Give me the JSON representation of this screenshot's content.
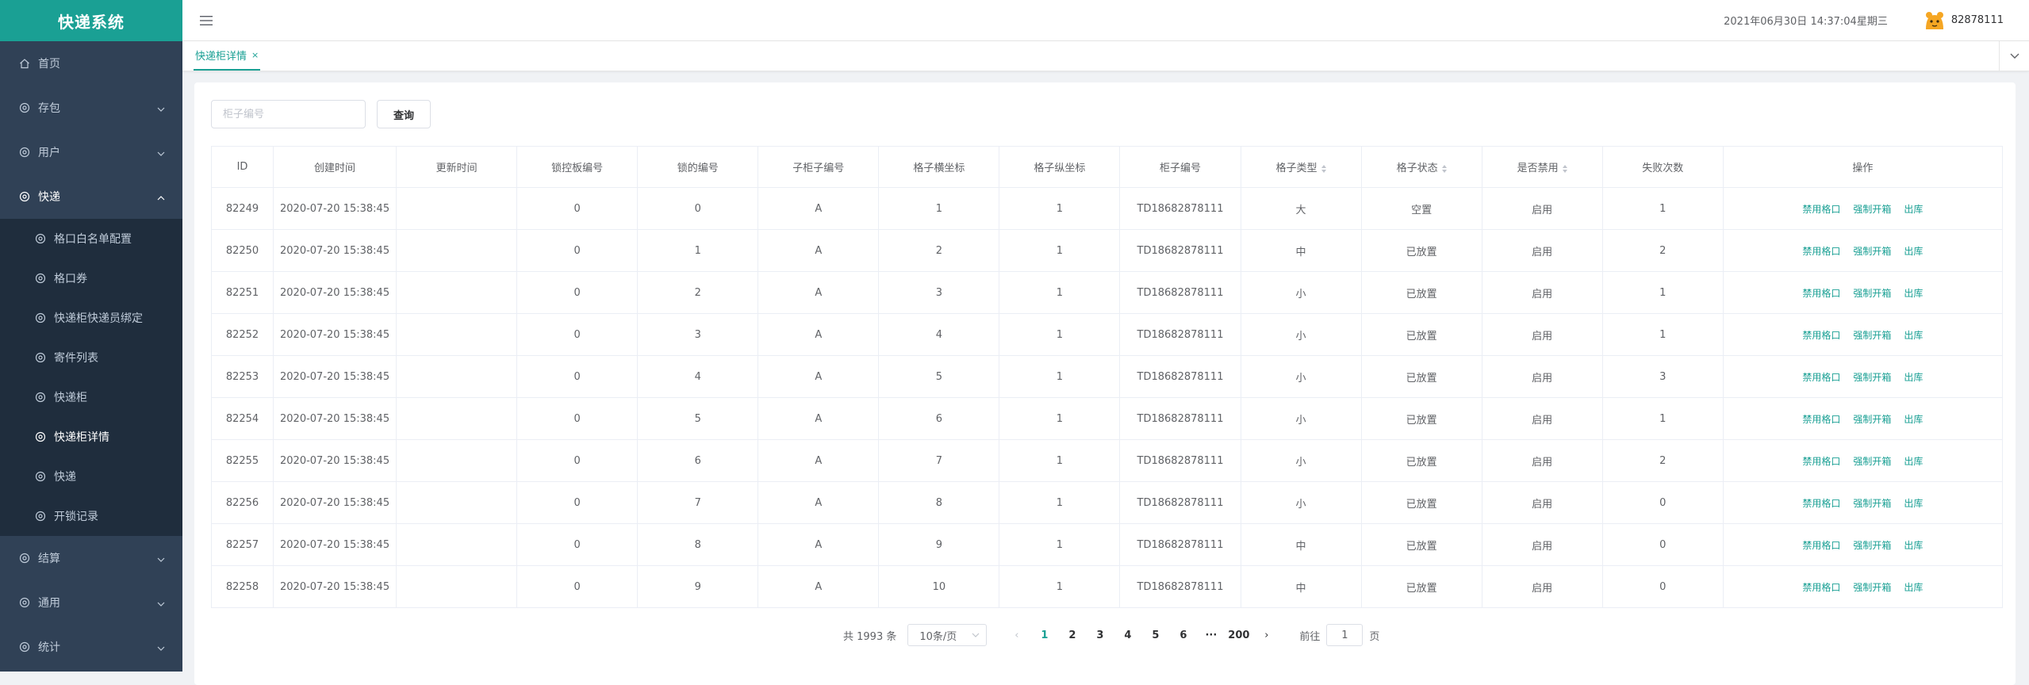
{
  "app": {
    "title": "快递系统",
    "datetime": "2021年06月30日 14:37:04星期三",
    "username": "82878111"
  },
  "sidebar": {
    "items": [
      {
        "label": "首页",
        "icon": "home-icon"
      },
      {
        "label": "存包",
        "icon": "gear-icon"
      },
      {
        "label": "用户",
        "icon": "gear-icon"
      },
      {
        "label": "快递",
        "icon": "gear-icon"
      },
      {
        "label": "结算",
        "icon": "gear-icon"
      },
      {
        "label": "通用",
        "icon": "gear-icon"
      },
      {
        "label": "统计",
        "icon": "gear-icon"
      }
    ],
    "sub_items": [
      {
        "label": "格口白名单配置"
      },
      {
        "label": "格口券"
      },
      {
        "label": "快递柜快递员绑定"
      },
      {
        "label": "寄件列表"
      },
      {
        "label": "快递柜"
      },
      {
        "label": "快递柜详情"
      },
      {
        "label": "快递"
      },
      {
        "label": "开锁记录"
      }
    ],
    "active_sub_item": "快递柜详情"
  },
  "tags": {
    "active_tag": "快递柜详情",
    "close_glyph": "×"
  },
  "search": {
    "placeholder": "柜子编号",
    "value": "",
    "button_label": "查询"
  },
  "table": {
    "columns": [
      "ID",
      "创建时间",
      "更新时间",
      "锁控板编号",
      "锁的编号",
      "子柜子编号",
      "格子横坐标",
      "格子纵坐标",
      "柜子编号",
      "格子类型",
      "格子状态",
      "是否禁用",
      "失败次数",
      "操作"
    ],
    "sortable_columns": [
      "格子类型",
      "格子状态",
      "是否禁用"
    ],
    "action_labels": [
      "禁用格口",
      "强制开箱",
      "出库"
    ],
    "rows": [
      [
        "82249",
        "2020-07-20 15:38:45",
        "",
        "0",
        "0",
        "A",
        "1",
        "1",
        "TD18682878111",
        "大",
        "空置",
        "启用",
        "1"
      ],
      [
        "82250",
        "2020-07-20 15:38:45",
        "",
        "0",
        "1",
        "A",
        "2",
        "1",
        "TD18682878111",
        "中",
        "已放置",
        "启用",
        "2"
      ],
      [
        "82251",
        "2020-07-20 15:38:45",
        "",
        "0",
        "2",
        "A",
        "3",
        "1",
        "TD18682878111",
        "小",
        "已放置",
        "启用",
        "1"
      ],
      [
        "82252",
        "2020-07-20 15:38:45",
        "",
        "0",
        "3",
        "A",
        "4",
        "1",
        "TD18682878111",
        "小",
        "已放置",
        "启用",
        "1"
      ],
      [
        "82253",
        "2020-07-20 15:38:45",
        "",
        "0",
        "4",
        "A",
        "5",
        "1",
        "TD18682878111",
        "小",
        "已放置",
        "启用",
        "3"
      ],
      [
        "82254",
        "2020-07-20 15:38:45",
        "",
        "0",
        "5",
        "A",
        "6",
        "1",
        "TD18682878111",
        "小",
        "已放置",
        "启用",
        "1"
      ],
      [
        "82255",
        "2020-07-20 15:38:45",
        "",
        "0",
        "6",
        "A",
        "7",
        "1",
        "TD18682878111",
        "小",
        "已放置",
        "启用",
        "2"
      ],
      [
        "82256",
        "2020-07-20 15:38:45",
        "",
        "0",
        "7",
        "A",
        "8",
        "1",
        "TD18682878111",
        "小",
        "已放置",
        "启用",
        "0"
      ],
      [
        "82257",
        "2020-07-20 15:38:45",
        "",
        "0",
        "8",
        "A",
        "9",
        "1",
        "TD18682878111",
        "中",
        "已放置",
        "启用",
        "0"
      ],
      [
        "82258",
        "2020-07-20 15:38:45",
        "",
        "0",
        "9",
        "A",
        "10",
        "1",
        "TD18682878111",
        "中",
        "已放置",
        "启用",
        "0"
      ]
    ]
  },
  "pagination": {
    "total_text": "共 1993 条",
    "page_size": "10条/页",
    "prev_glyph": "‹",
    "next_glyph": "›",
    "pages": [
      "1",
      "2",
      "3",
      "4",
      "5",
      "6",
      "···",
      "200"
    ],
    "current_page": "1",
    "goto_label": "前往",
    "goto_value": "1",
    "goto_suffix": "页"
  },
  "colors": {
    "brand": "#1aa094",
    "sidebar_bg": "#304156",
    "submenu_bg": "#1f2d3d"
  }
}
